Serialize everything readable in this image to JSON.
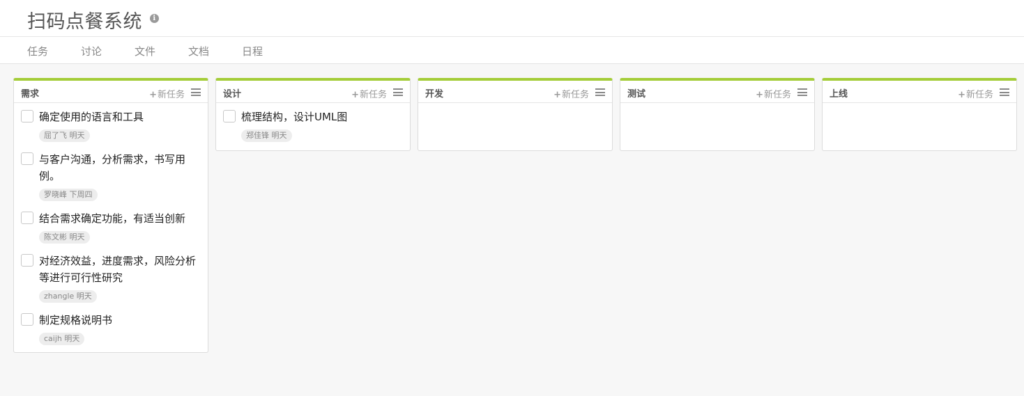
{
  "project": {
    "title": "扫码点餐系统",
    "info_icon": "info-icon"
  },
  "tabs": [
    "任务",
    "讨论",
    "文件",
    "文档",
    "日程"
  ],
  "board": {
    "new_task_label": "新任务",
    "accent_color": "#a4cd39",
    "columns": [
      {
        "title": "需求",
        "tasks": [
          {
            "text": "确定使用的语言和工具",
            "tag": "屈了飞 明天"
          },
          {
            "text": "与客户沟通，分析需求，书写用例。",
            "tag": "罗晓峰 下周四"
          },
          {
            "text": "结合需求确定功能，有适当创新",
            "tag": "陈文彬 明天"
          },
          {
            "text": "对经济效益，进度需求，风险分析等进行可行性研究",
            "tag": "zhangle 明天"
          },
          {
            "text": "制定规格说明书",
            "tag": "caijh 明天"
          }
        ]
      },
      {
        "title": "设计",
        "tasks": [
          {
            "text": "梳理结构，设计UML图",
            "tag": "郑佳锋 明天"
          }
        ]
      },
      {
        "title": "开发",
        "tasks": []
      },
      {
        "title": "测试",
        "tasks": []
      },
      {
        "title": "上线",
        "tasks": []
      }
    ]
  }
}
